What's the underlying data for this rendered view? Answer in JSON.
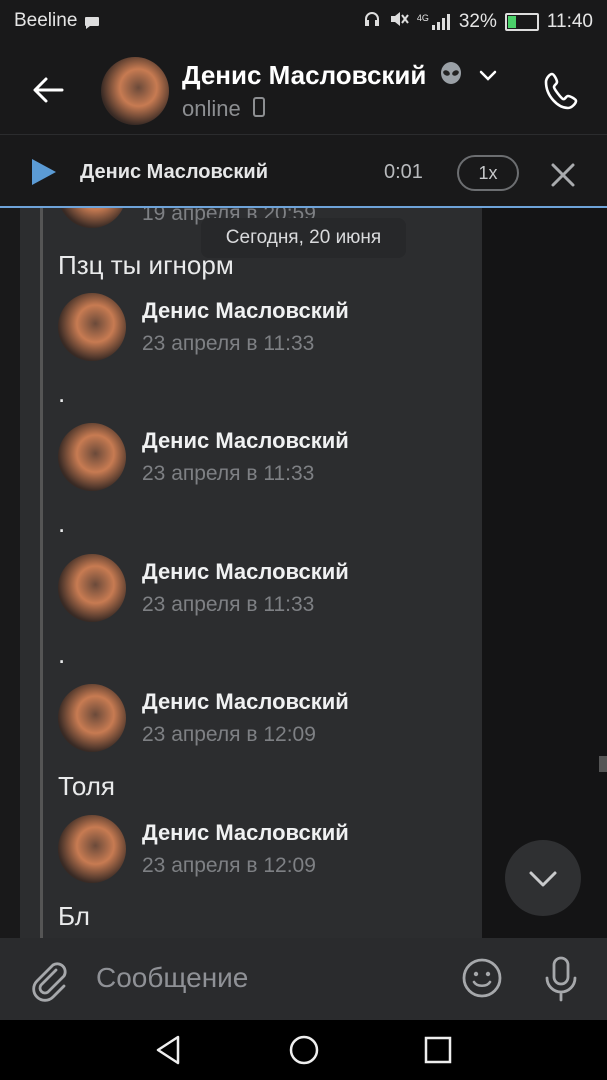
{
  "status_bar": {
    "carrier": "Beeline",
    "network": "4G",
    "battery": "32%",
    "battery_level": 0.32,
    "time": "11:40"
  },
  "header": {
    "contact_name": "Денис Масловский",
    "status": "online"
  },
  "player": {
    "track_title": "Денис Масловский",
    "elapsed": "0:01",
    "speed": "1x"
  },
  "chat": {
    "date_chip": "Сегодня, 20 июня",
    "partial_time": "19 апреля в 20:59",
    "messages": [
      {
        "author": "",
        "time": "",
        "text": "Пзц ты игнорм"
      },
      {
        "author": "Денис Масловский",
        "time": "23 апреля в 11:33",
        "text": "."
      },
      {
        "author": "Денис Масловский",
        "time": "23 апреля в 11:33",
        "text": "."
      },
      {
        "author": "Денис Масловский",
        "time": "23 апреля в 11:33",
        "text": "."
      },
      {
        "author": "Денис Масловский",
        "time": "23 апреля в 12:09",
        "text": "Толя"
      },
      {
        "author": "Денис Масловский",
        "time": "23 апреля в 12:09",
        "text": "Бл"
      }
    ]
  },
  "composer": {
    "placeholder": "Сообщение"
  },
  "colors": {
    "accent": "#5b9bd5",
    "background": "#19191a",
    "bubble": "#2c2d2f"
  }
}
